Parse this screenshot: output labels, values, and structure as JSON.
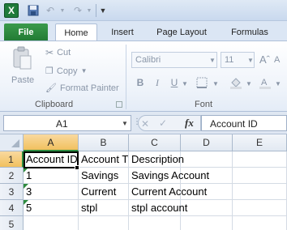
{
  "app": {
    "logo_text": "X",
    "colors": {
      "file_tab": "#217a33",
      "accent": "#2b8a3e",
      "selected_header": "#f1c15f"
    }
  },
  "qat": {
    "save_icon": "save-icon",
    "undo_icon": "undo-icon",
    "redo_icon": "redo-icon"
  },
  "tabs": {
    "file": "File",
    "home": "Home",
    "insert": "Insert",
    "page_layout": "Page Layout",
    "formulas": "Formulas"
  },
  "ribbon": {
    "clipboard": {
      "paste": "Paste",
      "cut": "Cut",
      "copy": "Copy",
      "format_painter": "Format Painter",
      "group_label": "Clipboard"
    },
    "font": {
      "name": "Calibri",
      "size": "11",
      "bold": "B",
      "italic": "I",
      "underline": "U",
      "group_label": "Font"
    }
  },
  "formula_bar": {
    "name_box": "A1",
    "fx": "fx",
    "content": "Account ID"
  },
  "grid": {
    "columns": [
      "A",
      "B",
      "C",
      "D",
      "E"
    ],
    "rows": [
      "1",
      "2",
      "3",
      "4",
      "5"
    ],
    "cells": [
      [
        "Account ID",
        "Account Type",
        "Description",
        "",
        ""
      ],
      [
        "1",
        "Savings",
        "Savings Account",
        "",
        ""
      ],
      [
        "3",
        "Current",
        "Current Account",
        "",
        ""
      ],
      [
        "5",
        "stpl",
        "stpl account",
        "",
        ""
      ],
      [
        "",
        "",
        "",
        "",
        ""
      ]
    ]
  }
}
